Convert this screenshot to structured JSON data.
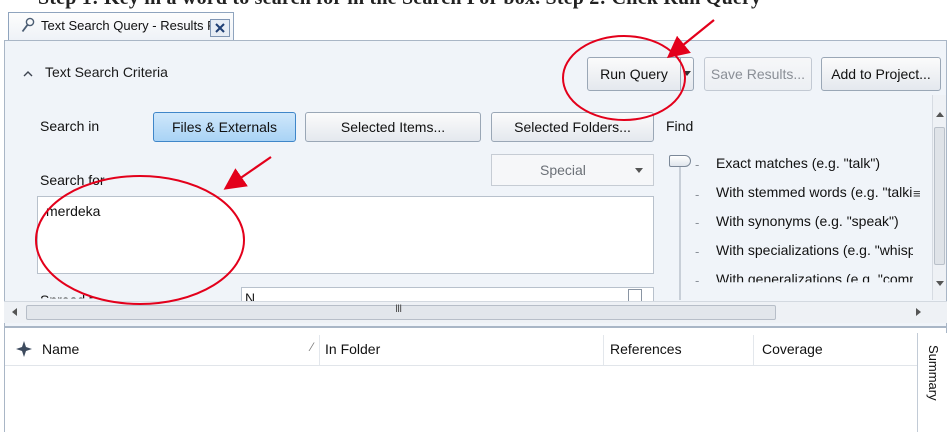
{
  "caption": {
    "text": "Step 1: Key in a word to search for in the Search For box. Step 2: Click Run Query"
  },
  "tab": {
    "title": "Text Search Query - Results Pre",
    "icon": "magnifier-icon",
    "close_icon": "close-icon"
  },
  "criteria": {
    "header": "Text Search Criteria",
    "toggle_icon": "chevron-up-icon"
  },
  "toolbar": {
    "run_query": "Run Query",
    "save_results": "Save Results...",
    "add_to_project": "Add to Project..."
  },
  "search_in": {
    "label": "Search in",
    "options": [
      "Files & Externals",
      "Selected Items...",
      "Selected Folders..."
    ],
    "active": "Files & Externals"
  },
  "search_for": {
    "label": "Search for",
    "value": "merdeka",
    "special_label": "Special"
  },
  "find": {
    "label": "Find",
    "options": [
      "Exact matches (e.g. \"talk\")",
      "With stemmed words (e.g. \"talkir",
      "With synonyms (e.g. \"speak\")",
      "With specializations (e.g. \"whispe",
      "With generalizations (e.g. \"comm"
    ]
  },
  "partial_row": {
    "label": "Spread to",
    "value": "N"
  },
  "results": {
    "columns": [
      "Name",
      "In Folder",
      "References",
      "Coverage"
    ],
    "side_tab": "Summary"
  },
  "annotation_color": "#e3001b"
}
